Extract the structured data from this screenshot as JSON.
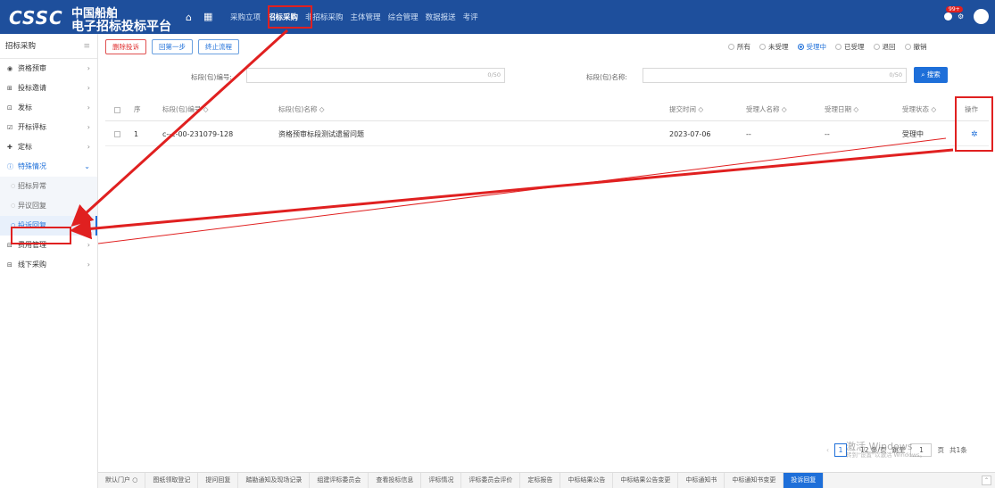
{
  "header": {
    "logo": "CSSC",
    "brand_line1": "中国船舶",
    "brand_line2": "电子招标投标平台",
    "nav": [
      "采购立项",
      "招标采购",
      "非招标采购",
      "主体管理",
      "综合管理",
      "数据报送",
      "考评"
    ],
    "active_nav": "招标采购",
    "notification_badge": "99+"
  },
  "sidebar": {
    "title": "招标采购",
    "items": [
      {
        "icon": "eye-icon",
        "glyph": "◉",
        "label": "资格预审"
      },
      {
        "icon": "invite-icon",
        "glyph": "⊞",
        "label": "投标邀请"
      },
      {
        "icon": "doc-icon",
        "glyph": "⊡",
        "label": "发标"
      },
      {
        "icon": "edit-icon",
        "glyph": "☑",
        "label": "开标评标"
      },
      {
        "icon": "pin-icon",
        "glyph": "✚",
        "label": "定标"
      },
      {
        "icon": "info-icon",
        "glyph": "ⓘ",
        "label": "特殊情况"
      }
    ],
    "sub_items": [
      "招标异常",
      "异议回复",
      "投诉回复"
    ],
    "items_after": [
      {
        "icon": "fee-icon",
        "glyph": "⊟",
        "label": "费用管理"
      },
      {
        "icon": "offline-icon",
        "glyph": "⊟",
        "label": "线下采购"
      }
    ]
  },
  "toolbar": {
    "delete_label": "删除投诉",
    "back_label": "回第一步",
    "stop_label": "终止流程"
  },
  "status_filter": {
    "options": [
      "所有",
      "未受理",
      "受理中",
      "已受理",
      "退回",
      "撤销"
    ],
    "selected": "受理中"
  },
  "search": {
    "code_label": "标段(包)编号:",
    "code_count": "0/50",
    "name_label": "标段(包)名称:",
    "name_count": "0/50",
    "button_label": "搜索"
  },
  "table": {
    "columns": {
      "seq": "序",
      "code": "标段(包)编号 ◇",
      "name": "标段(包)名称 ◇",
      "submit_time": "提交时间 ◇",
      "acceptor": "受理人名称 ◇",
      "accept_date": "受理日期 ◇",
      "status": "受理状态 ◇",
      "op": "操作"
    },
    "rows": [
      {
        "seq": "1",
        "code": "c--c-00-231079-128",
        "name": "资格预审标段测试遗留问题",
        "submit_time": "2023-07-06",
        "acceptor": "--",
        "accept_date": "--",
        "status": "受理中"
      }
    ]
  },
  "pagination": {
    "current": "1",
    "per_page": "12 条/页",
    "goto_label": "跳至",
    "goto_value": "1",
    "page_suffix": "页",
    "total": "共1条"
  },
  "watermark": {
    "line1": "激活 Windows",
    "line2": "转到\"设置\"以激活 Windows。"
  },
  "tabs": [
    "默认门户 ○",
    "图纸领取登记",
    "提问回复",
    "踏勘通知及现场记录",
    "组建评标委员会",
    "查看投标信息",
    "评标情况",
    "评标委员会评价",
    "定标报告",
    "中标结果公告",
    "中标结果公告变更",
    "中标通知书",
    "中标通知书变更",
    "投诉回复"
  ],
  "active_tab": "投诉回复",
  "colors": {
    "header_bg": "#1e4f9c",
    "accent": "#1e6fd9",
    "annotation_red": "#e02020"
  }
}
